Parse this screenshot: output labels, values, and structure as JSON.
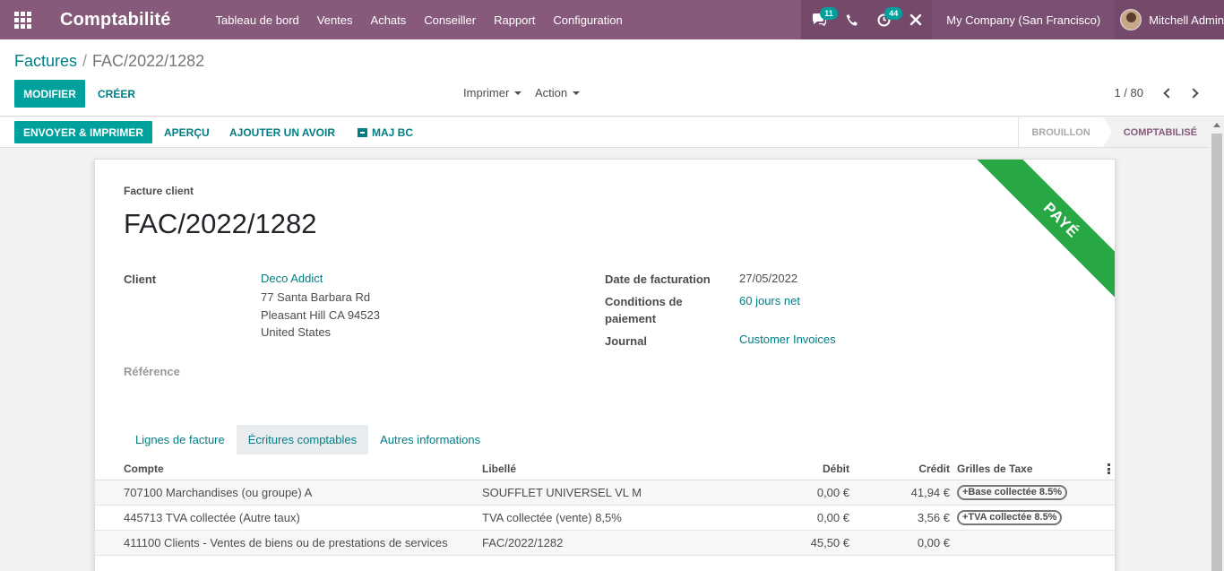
{
  "navbar": {
    "app_title": "Comptabilité",
    "menu": [
      "Tableau de bord",
      "Ventes",
      "Achats",
      "Conseiller",
      "Rapport",
      "Configuration"
    ],
    "messages_badge": "11",
    "activities_badge": "44",
    "company": "My Company (San Francisco)",
    "user": "Mitchell Admin"
  },
  "breadcrumb": {
    "parent": "Factures",
    "separator": "/",
    "current": "FAC/2022/1282"
  },
  "control": {
    "edit_label": "MODIFIER",
    "create_label": "CRÉER",
    "print_label": "Imprimer",
    "action_label": "Action",
    "pager": "1 / 80"
  },
  "statusbar": {
    "send_print_label": "ENVOYER & IMPRIMER",
    "preview_label": "APERÇU",
    "credit_note_label": "AJOUTER UN AVOIR",
    "update_po_label": "MAJ BC",
    "stages": [
      {
        "label": "BROUILLON",
        "active": false
      },
      {
        "label": "COMPTABILISÉ",
        "active": true
      }
    ]
  },
  "form": {
    "ribbon": "PAYÉ",
    "subtitle": "Facture client",
    "name": "FAC/2022/1282",
    "client_label": "Client",
    "client_name": "Deco Addict",
    "client_address": [
      "77 Santa Barbara Rd",
      "Pleasant Hill CA 94523",
      "United States"
    ],
    "reference_label": "Référence",
    "invoice_date_label": "Date de facturation",
    "invoice_date": "27/05/2022",
    "payment_terms_label_1": "Conditions de",
    "payment_terms_label_2": "paiement",
    "payment_terms": "60 jours net",
    "journal_label": "Journal",
    "journal": "Customer Invoices"
  },
  "tabs": [
    {
      "label": "Lignes de facture",
      "active": false
    },
    {
      "label": "Écritures comptables",
      "active": true
    },
    {
      "label": "Autres informations",
      "active": false
    }
  ],
  "table": {
    "headers": {
      "compte": "Compte",
      "libelle": "Libellé",
      "debit": "Débit",
      "credit": "Crédit",
      "grilles": "Grilles de Taxe"
    },
    "rows": [
      {
        "compte": "707100 Marchandises (ou groupe) A",
        "libelle": "SOUFFLET UNIVERSEL VL M",
        "debit": "0,00 €",
        "credit": "41,94 €",
        "tag": "+Base collectée 8.5%"
      },
      {
        "compte": "445713 TVA collectée (Autre taux)",
        "libelle": "TVA collectée (vente) 8,5%",
        "debit": "0,00 €",
        "credit": "3,56 €",
        "tag": "+TVA collectée 8.5%"
      },
      {
        "compte": "411100 Clients - Ventes de biens ou de prestations de services",
        "libelle": "FAC/2022/1282",
        "debit": "45,50 €",
        "credit": "0,00 €",
        "tag": ""
      }
    ]
  },
  "icons": {
    "apps": "apps-grid-icon",
    "messages": "chat-icon",
    "phone": "phone-icon",
    "activities": "clock-icon",
    "debug": "tools-icon"
  },
  "colors": {
    "brand": "#875a7b",
    "primary": "#00a09d",
    "link": "#017e84",
    "ribbon": "#28a745"
  }
}
